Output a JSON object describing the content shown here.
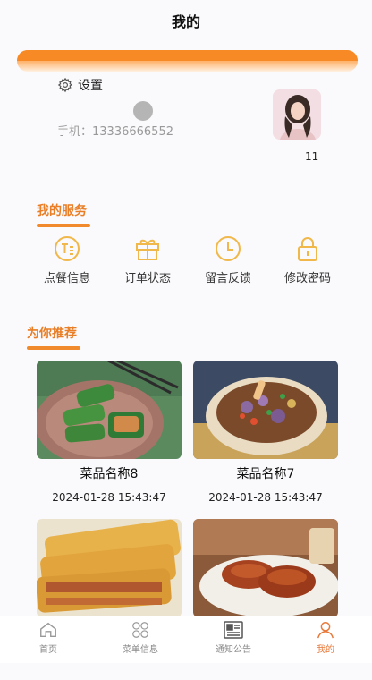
{
  "header": {
    "title": "我的"
  },
  "profile": {
    "settings_label": "设置",
    "phone_text": "手机：13336666552",
    "avatar_label": "11"
  },
  "services": {
    "title": "我的服务",
    "items": [
      {
        "label": "点餐信息",
        "icon": "order-info-icon"
      },
      {
        "label": "订单状态",
        "icon": "gift-box-icon"
      },
      {
        "label": "留言反馈",
        "icon": "clock-icon"
      },
      {
        "label": "修改密码",
        "icon": "lock-icon"
      }
    ]
  },
  "recommend": {
    "title": "为你推荐",
    "items": [
      {
        "name": "菜品名称8",
        "time": "2024-01-28 15:43:47"
      },
      {
        "name": "菜品名称7",
        "time": "2024-01-28 15:43:47"
      },
      {
        "name": "",
        "time": ""
      },
      {
        "name": "",
        "time": ""
      }
    ]
  },
  "tabbar": {
    "items": [
      {
        "label": "首页",
        "icon": "home-icon"
      },
      {
        "label": "菜单信息",
        "icon": "grid-icon"
      },
      {
        "label": "通知公告",
        "icon": "newspaper-icon"
      },
      {
        "label": "我的",
        "icon": "person-icon"
      }
    ]
  },
  "colors": {
    "accent": "#f08a2c",
    "service_icon": "#f0b84a",
    "tab_active": "#e8793a"
  }
}
